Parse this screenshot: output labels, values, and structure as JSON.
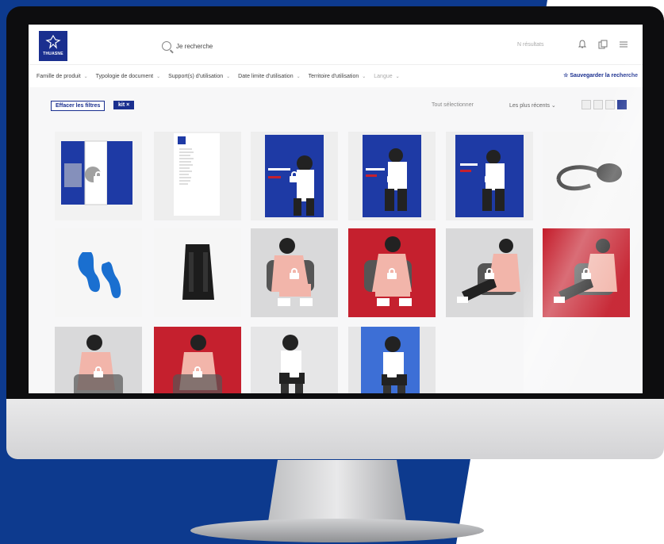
{
  "colors": {
    "brand": "#1a2f8f",
    "red_bg": "#c5202e",
    "bg_blue": "#0d3a8e"
  },
  "header": {
    "logo_text": "THUASNE",
    "search_placeholder": "Je recherche",
    "results_text": "N résultats",
    "icons": [
      "bell-icon",
      "copy-icon",
      "menu-icon"
    ]
  },
  "filters": [
    {
      "label": "Famille de produit"
    },
    {
      "label": "Typologie de document"
    },
    {
      "label": "Support(s) d'utilisation"
    },
    {
      "label": "Date limite d'utilisation"
    },
    {
      "label": "Territoire d'utilisation"
    },
    {
      "label": "Langue"
    }
  ],
  "save_search": "Sauvegarder la recherche",
  "toolbar": {
    "clear_filters": "Effacer les filtres",
    "active_chip": "kit",
    "select_all": "Tout sélectionner",
    "sort": "Les plus récents"
  },
  "tiles": [
    {
      "kind": "box",
      "locked": true
    },
    {
      "kind": "doc",
      "locked": false
    },
    {
      "kind": "brochure",
      "locked": true
    },
    {
      "kind": "brochure",
      "locked": true
    },
    {
      "kind": "brochure",
      "locked": true
    },
    {
      "kind": "tube",
      "locked": false
    },
    {
      "kind": "insole",
      "locked": false
    },
    {
      "kind": "brace",
      "locked": false
    },
    {
      "kind": "person-grey",
      "locked": true
    },
    {
      "kind": "person-red",
      "locked": true
    },
    {
      "kind": "person-grey",
      "locked": true
    },
    {
      "kind": "person-red",
      "locked": true
    },
    {
      "kind": "person-grey",
      "locked": true
    },
    {
      "kind": "person-red",
      "locked": true
    },
    {
      "kind": "person-grey",
      "locked": true
    },
    {
      "kind": "person-blue",
      "locked": true
    }
  ]
}
